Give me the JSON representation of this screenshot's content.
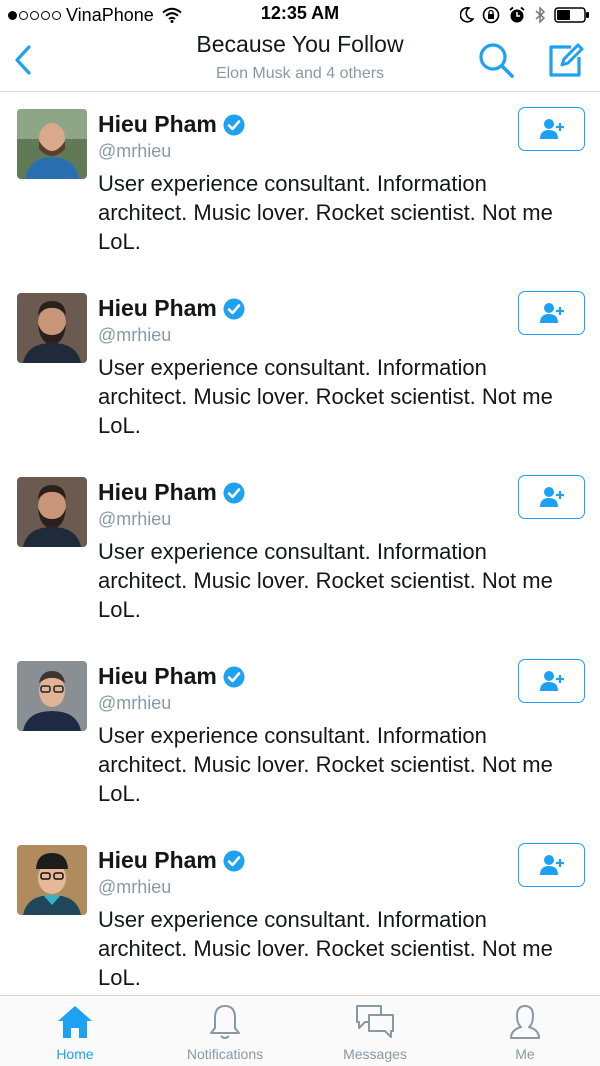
{
  "status_bar": {
    "carrier": "VinaPhone",
    "signal_bars": 1,
    "time": "12:35 AM"
  },
  "nav": {
    "title": "Because You Follow",
    "subtitle": "Elon Musk and 4 others",
    "accent_color": "#1da1f2"
  },
  "users": [
    {
      "name": "Hieu Pham",
      "handle": "@mrhieu",
      "bio": "User experience consultant. Information architect. Music lover. Rocket scientist. Not me LoL.",
      "verified": true,
      "avatar": "avatar-outdoor-beard"
    },
    {
      "name": "Hieu Pham",
      "handle": "@mrhieu",
      "bio": "User experience consultant. Information architect. Music lover. Rocket scientist. Not me LoL.",
      "verified": true,
      "avatar": "avatar-beard-dark"
    },
    {
      "name": "Hieu Pham",
      "handle": "@mrhieu",
      "bio": "User experience consultant. Information architect. Music lover. Rocket scientist. Not me LoL.",
      "verified": true,
      "avatar": "avatar-beard-dark"
    },
    {
      "name": "Hieu Pham",
      "handle": "@mrhieu",
      "bio": "User experience consultant. Information architect. Music lover. Rocket scientist. Not me LoL.",
      "verified": true,
      "avatar": "avatar-glasses"
    },
    {
      "name": "Hieu Pham",
      "handle": "@mrhieu",
      "bio": "User experience consultant. Information architect. Music lover. Rocket scientist. Not me LoL.",
      "verified": true,
      "avatar": "avatar-cap-glasses"
    }
  ],
  "tabs": [
    {
      "label": "Home",
      "icon": "home-icon",
      "active": true
    },
    {
      "label": "Notifications",
      "icon": "bell-icon",
      "active": false
    },
    {
      "label": "Messages",
      "icon": "messages-icon",
      "active": false
    },
    {
      "label": "Me",
      "icon": "person-icon",
      "active": false
    }
  ]
}
